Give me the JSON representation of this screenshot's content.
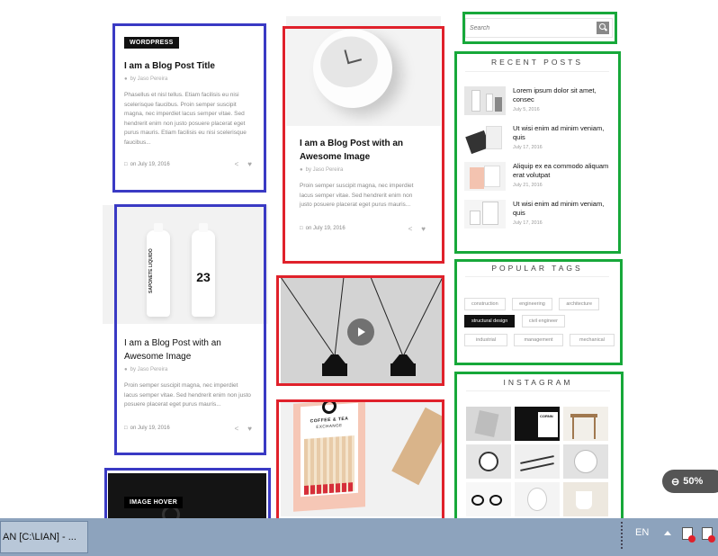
{
  "col1": {
    "post1": {
      "badge": "WORDPRESS",
      "title": "I am a Blog Post Title",
      "author": "by Jaso Pereira",
      "excerpt": "Phasellus et nisl tellus. Etiam facilisis eu nisi scelerisque faucibus. Proin semper suscipit magna, nec imperdiet lacus semper vitae. Sed hendrerit enim non justo posuere placerat eget purus mauris. Etiam facilisis eu nisi scelerisque faucibus...",
      "date": "on July 19, 2016"
    },
    "post2": {
      "bottle_label": "23",
      "bottle_text": "SAPONETE LIQUIDO",
      "title": "I am a Blog Post with an Awesome Image",
      "author": "by Jaso Pereira",
      "excerpt": "Proin semper suscipit magna, nec imperdiet lacus semper vitae. Sed hendrerit enim non justo posuere placerat eget purus mauris...",
      "date": "on July 19, 2016"
    },
    "post3": {
      "badge": "IMAGE HOVER"
    }
  },
  "col2": {
    "post1": {
      "title": "I am a Blog Post with an Awesome Image",
      "author": "by Jaso Pereira",
      "excerpt": "Proin semper suscipit magna, nec imperdiet lacus semper vitae. Sed hendrerit enim non justo posuere placerat eget purus mauris...",
      "date": "on July 19, 2016"
    },
    "post3": {
      "brand_line1": "COFFEE & TEA",
      "brand_line2": "EXCHANGE"
    }
  },
  "sidebar": {
    "search_placeholder": "Search",
    "recent_title": "RECENT POSTS",
    "recent_posts": [
      {
        "title": "Lorem ipsum dolor sit amet, consec",
        "date": "July 5, 2016"
      },
      {
        "title": "Ut wisi enim ad minim veniam, quis",
        "date": "July 17, 2016"
      },
      {
        "title": "Aliquip ex ea commodo aliquam erat volutpat",
        "date": "July 21, 2016"
      },
      {
        "title": "Ut wisi enim ad minim veniam, quis",
        "date": "July 17, 2016"
      }
    ],
    "tags_title": "POPULAR TAGS",
    "tags": [
      "construction",
      "engineering",
      "architecture",
      "structural design",
      "civil engineer",
      "industrial",
      "management",
      "mechanical"
    ],
    "instagram_title": "INSTAGRAM",
    "instagram_brand": "CORNN"
  },
  "zoom": "50%",
  "taskbar": {
    "window_label": "AN [C:\\LIAN] - ...",
    "lang": "EN"
  },
  "colors": {
    "blue": "#3a3ac4",
    "red": "#e0212b",
    "green": "#17a83a",
    "taskbar": "#8da3bd"
  }
}
